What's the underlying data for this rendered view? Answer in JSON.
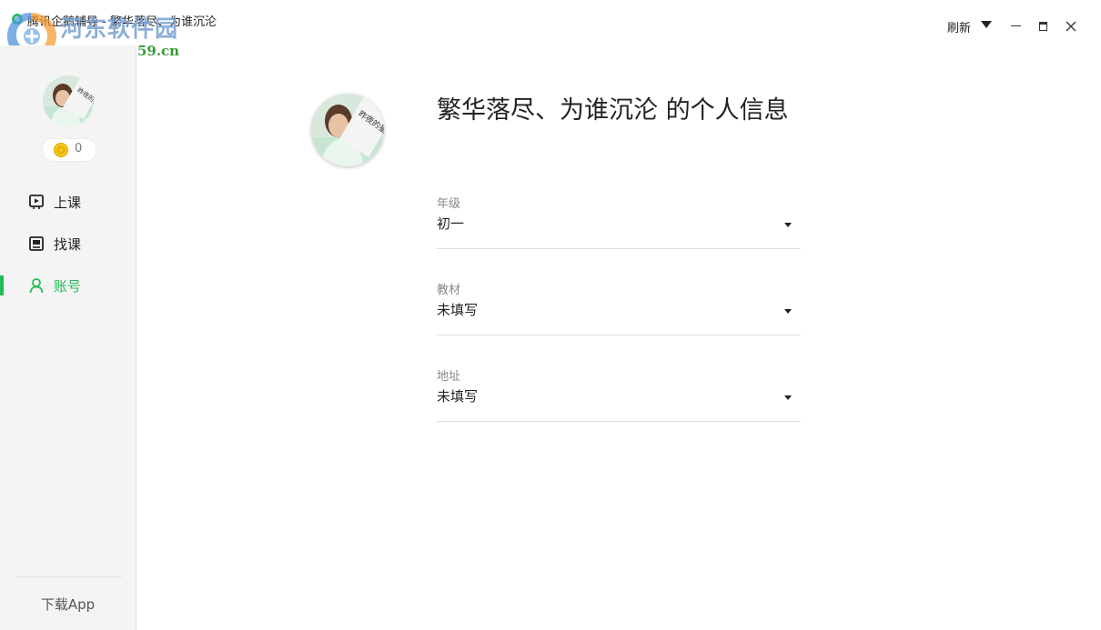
{
  "window": {
    "title": "腾讯企鹅辅导 - 繁华落尽、为谁沉沦",
    "refresh_label": "刷新"
  },
  "watermark": {
    "title": "河东软件园",
    "url": "www.pc0359.cn"
  },
  "sidebar": {
    "coin_count": "0",
    "nav": [
      {
        "label": "上课",
        "icon": "play-screen-icon",
        "active": false
      },
      {
        "label": "找课",
        "icon": "browse-icon",
        "active": false
      },
      {
        "label": "账号",
        "icon": "user-icon",
        "active": true
      }
    ],
    "download_label": "下载App"
  },
  "profile": {
    "avatar_text": "昨夜的星辰已坠落",
    "title": "繁华落尽、为谁沉沦 的个人信息",
    "fields": [
      {
        "label": "年级",
        "value": "初一"
      },
      {
        "label": "教材",
        "value": "未填写"
      },
      {
        "label": "地址",
        "value": "未填写"
      }
    ]
  },
  "colors": {
    "accent": "#22bb55",
    "sidebar_bg": "#f4f4f4",
    "divider": "#dcdcdc"
  }
}
